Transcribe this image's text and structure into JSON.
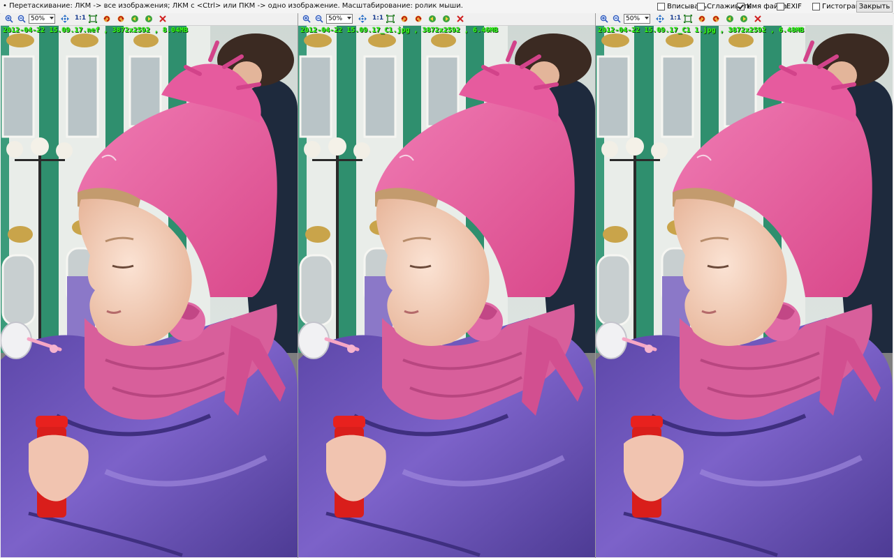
{
  "topbar": {
    "hint": "• Перетаскивание: ЛКМ -> все изображения; ЛКМ с <Ctrl> или ПКМ -> одно изображение. Масштабирование: ролик мыши.",
    "options": [
      {
        "label": "Вписывать",
        "checked": false
      },
      {
        "label": "Сглаживать",
        "checked": false
      },
      {
        "label": "Имя файла",
        "checked": true
      },
      {
        "label": "EXIF",
        "checked": false
      },
      {
        "label": "Гистограмма",
        "checked": false
      }
    ],
    "close_label": "Закрыть"
  },
  "toolbar": {
    "zoom": "50%",
    "one_to_one": "1:1"
  },
  "panes": [
    {
      "file_info": "2012-04-22 15.09.17.nef , 3872x2592 , 8.04MB"
    },
    {
      "file_info": "2012-04-22 15.09.17_C1.jpg , 3872x2592 , 6.46MB"
    },
    {
      "file_info": "2012-04-22 15.09.17_C1 1.jpg , 3872x2592 , 6.48MB"
    }
  ],
  "colors": {
    "label_green": "#39ff14",
    "hat_pink": "#e85a9a",
    "jacket_purple": "#6a4fb0",
    "building_green": "#2f8f6e",
    "delete_red": "#d02020"
  }
}
